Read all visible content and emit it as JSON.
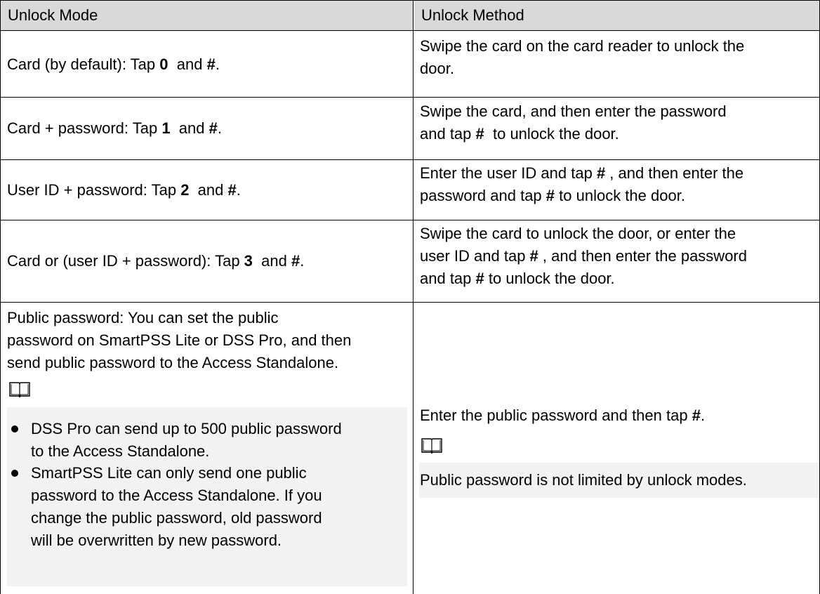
{
  "header": {
    "col1": "Unlock Mode",
    "col2": "Unlock Method"
  },
  "rows": [
    {
      "mode_prefix": "Card (by default): Tap ",
      "mode_key": "0",
      "mode_mid": "  and ",
      "mode_hash": "#",
      "mode_end": ".",
      "method_lines": [
        "Swipe the card on the card reader to unlock the",
        "door."
      ]
    },
    {
      "mode_prefix": "Card + password: Tap ",
      "mode_key": "1",
      "mode_mid": "  and ",
      "mode_hash": "#",
      "mode_end": ".",
      "method_line1": "Swipe the card, and then enter the password",
      "method_line2_a": "and tap ",
      "method_line2_hash": "#",
      "method_line2_b": "  to unlock the door."
    },
    {
      "mode_prefix": "User ID + password: Tap ",
      "mode_key": "2",
      "mode_mid": "  and ",
      "mode_hash": "#",
      "mode_end": ".",
      "method_line1_a": "Enter the user ID and tap ",
      "method_line1_hash": "#",
      "method_line1_b": " , and then enter the",
      "method_line2_a": "password and tap ",
      "method_line2_hash": "#",
      "method_line2_b": " to unlock the door."
    },
    {
      "mode_prefix": "Card or (user ID + password): Tap ",
      "mode_key": "3",
      "mode_mid": "  and ",
      "mode_hash": "#",
      "mode_end": ".",
      "method_line1": "Swipe the card to unlock the door, or enter the",
      "method_line2_a": "user ID and tap ",
      "method_line2_hash": "#",
      "method_line2_b": " , and then enter the password",
      "method_line3_a": "and tap ",
      "method_line3_hash": "#",
      "method_line3_b": " to unlock the door."
    },
    {
      "mode_lines": [
        "Public password: You can set the public",
        "password on SmartPSS Lite or DSS Pro, and then",
        "send public password to the Access Standalone."
      ],
      "mode_note_icon": "book-note-icon",
      "mode_bullets": [
        [
          "DSS Pro can send up to 500 public password",
          "to the Access Standalone."
        ],
        [
          "SmartPSS Lite can only send one public",
          "password to the Access Standalone. If you",
          "change the public password, old password",
          "will be overwritten by new password."
        ]
      ],
      "method_a": "Enter the public password and then tap ",
      "method_hash": "#",
      "method_b": ".",
      "method_note_icon": "book-note-icon",
      "method_note": "Public password is not limited by unlock modes."
    }
  ]
}
